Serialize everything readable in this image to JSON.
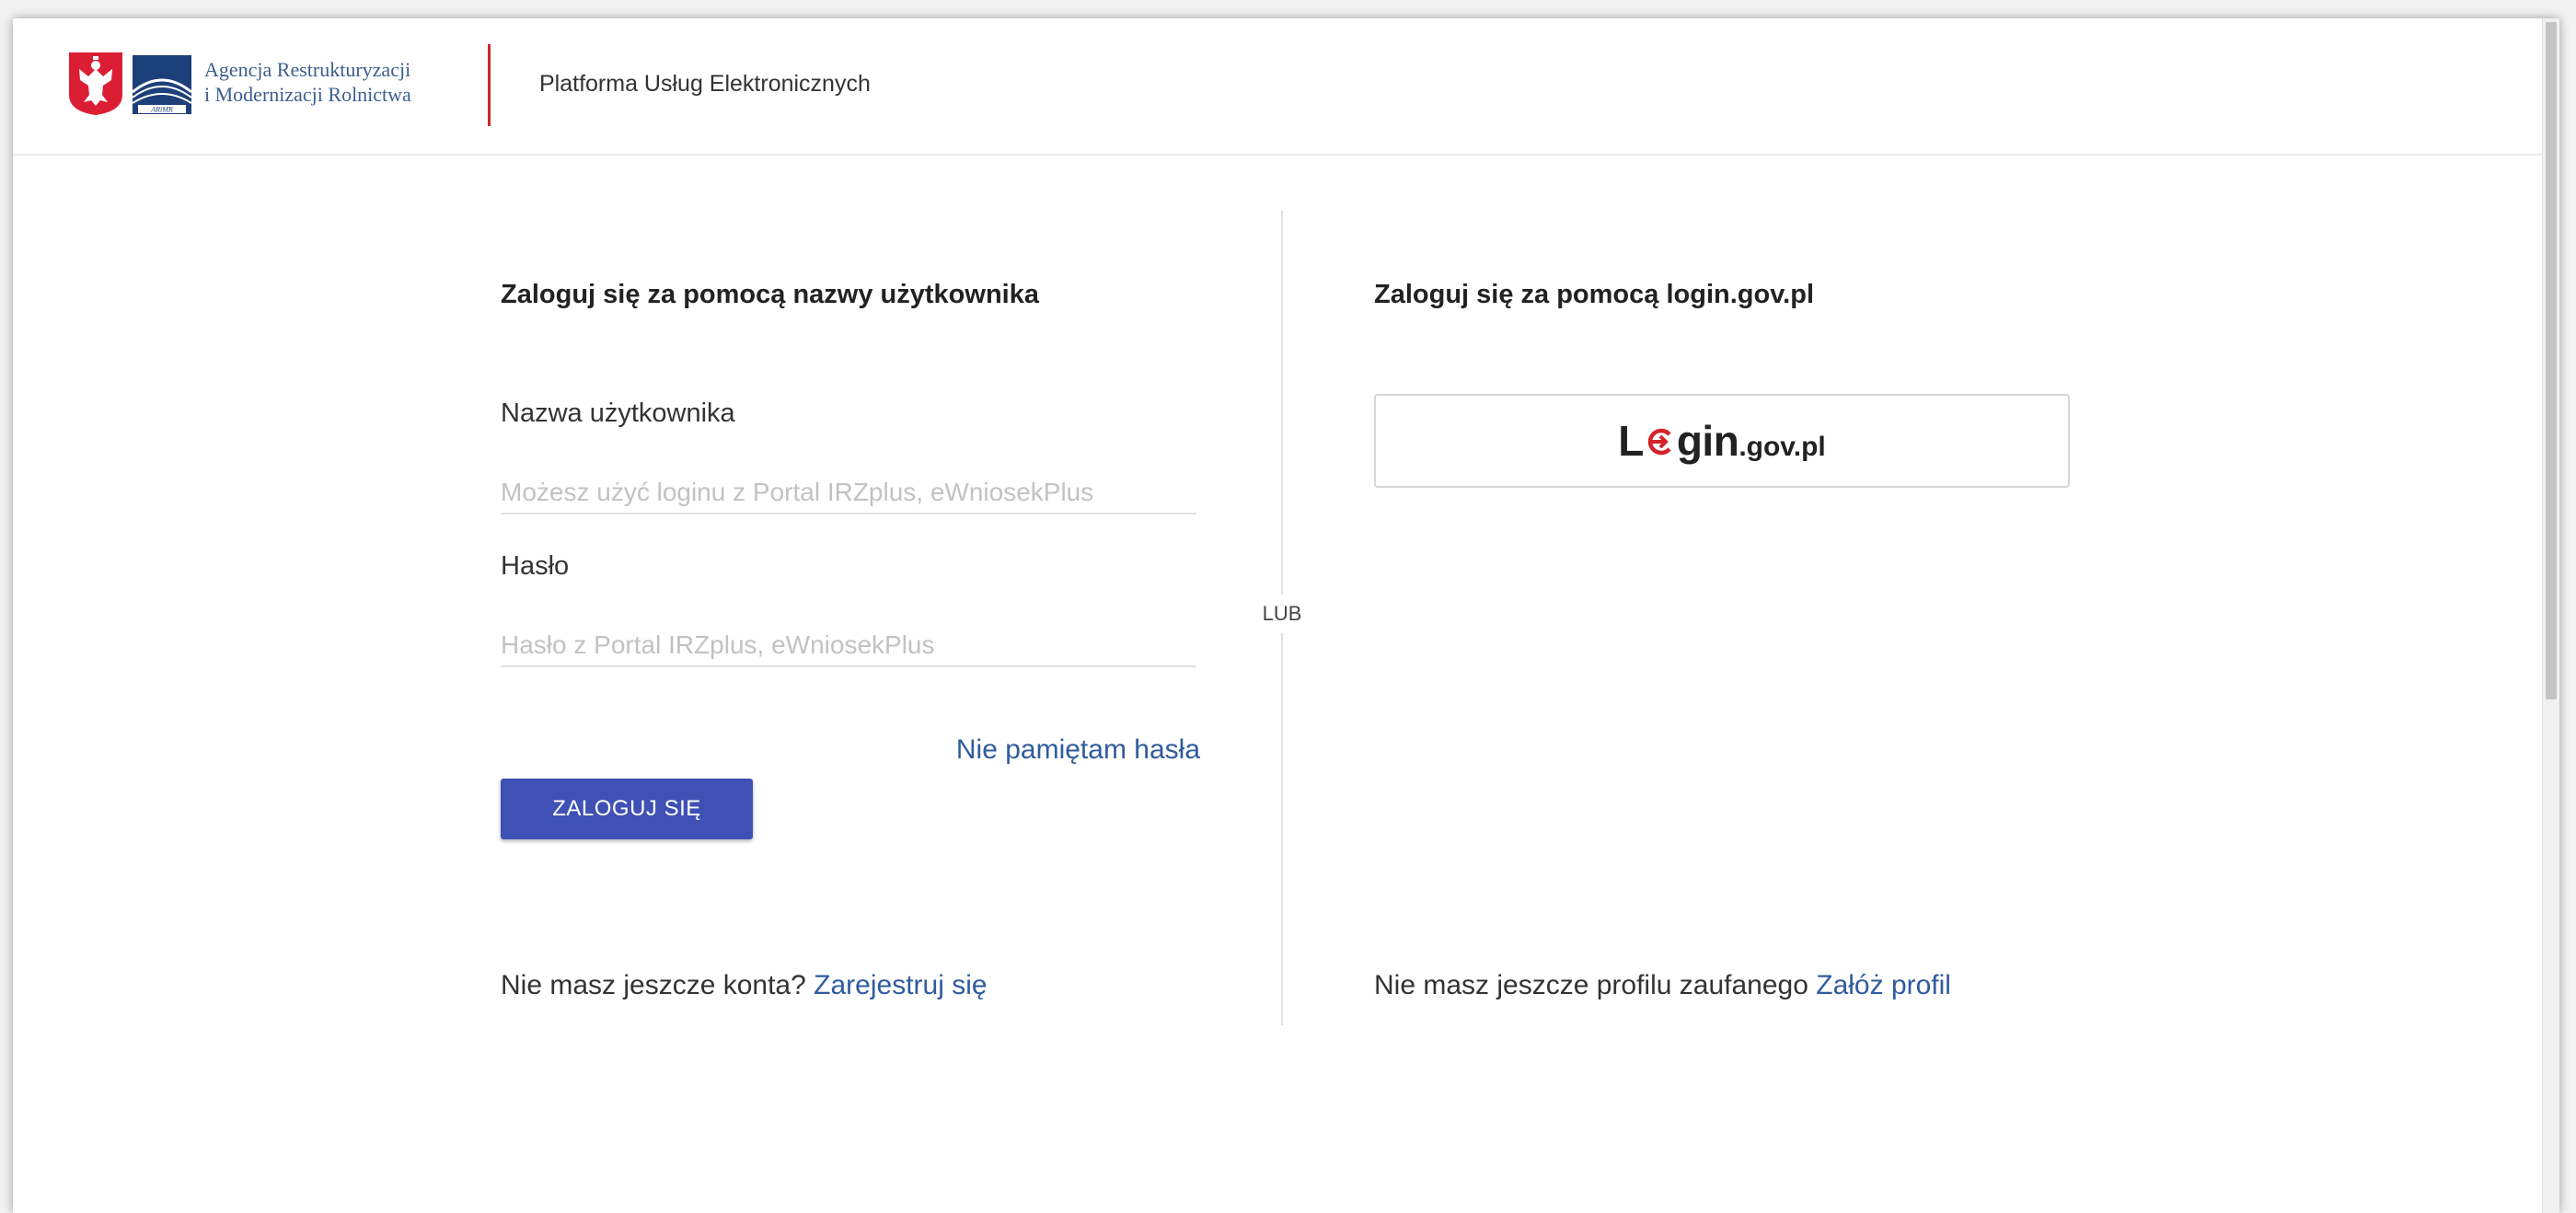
{
  "header": {
    "agency_line1": "Agencja Restrukturyzacji",
    "agency_line2": "i Modernizacji Rolnictwa",
    "logo_badge": "ARiMR",
    "platform_title": "Platforma Usług Elektronicznych"
  },
  "left": {
    "title": "Zaloguj się za pomocą nazwy użytkownika",
    "username_label": "Nazwa użytkownika",
    "username_placeholder": "Możesz użyć loginu z Portal IRZplus, eWniosekPlus",
    "password_label": "Hasło",
    "password_placeholder": "Hasło z Portal IRZplus, eWniosekPlus",
    "forgot_link": "Nie pamiętam hasła",
    "login_button": "ZALOGUJ SIĘ",
    "no_account_text": "Nie masz jeszcze konta?",
    "register_link": "Zarejestruj się"
  },
  "separator": {
    "label": "LUB"
  },
  "right": {
    "title": "Zaloguj się za pomocą login.gov.pl",
    "gov_logo_l": "L",
    "gov_logo_gin": "gin",
    "gov_logo_suffix": ".gov.pl",
    "no_profile_text": "Nie masz jeszcze profilu zaufanego",
    "create_profile_link": "Załóż profil"
  },
  "colors": {
    "primary_button": "#3f51b5",
    "link": "#2f5b9e",
    "header_divider": "#d2232a",
    "gov_accent": "#d2232a"
  },
  "icons": {
    "coat_of_arms": "polish-eagle-icon",
    "agency_logo": "arimr-logo-icon",
    "gov_o": "login-gov-arrow-icon"
  }
}
